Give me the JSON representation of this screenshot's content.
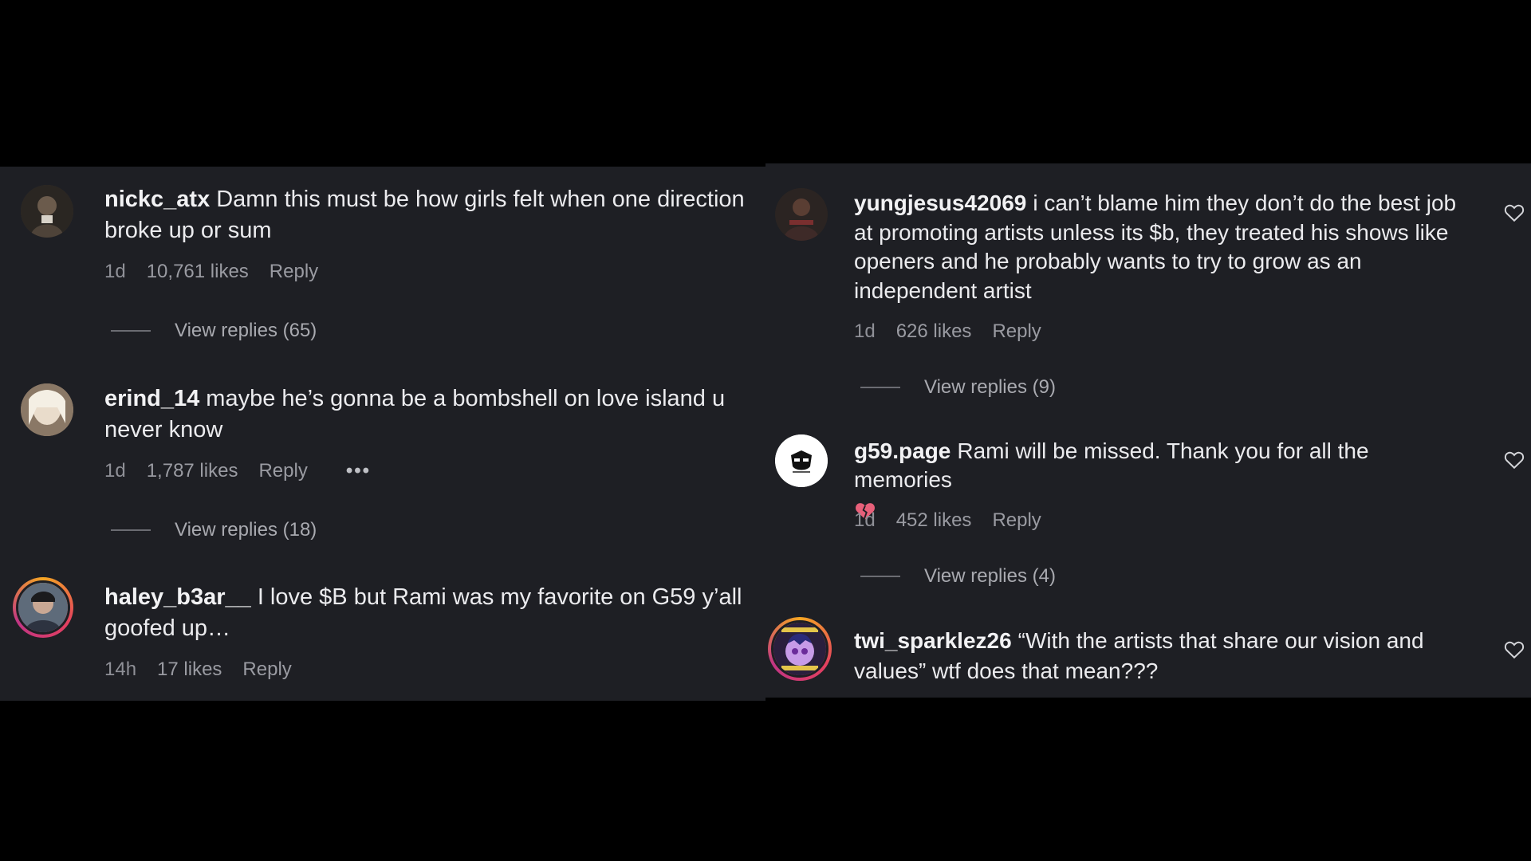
{
  "left_comments": [
    {
      "username": "nickc_atx",
      "text": "Damn this must be how girls felt when one direction broke up or sum",
      "time": "1d",
      "likes": "10,761 likes",
      "reply": "Reply",
      "view_replies": "View replies (65)"
    },
    {
      "username": "erind_14",
      "text": "maybe he’s gonna be a bombshell on love island u never know",
      "time": "1d",
      "likes": "1,787 likes",
      "reply": "Reply",
      "more": "•••",
      "view_replies": "View replies (18)"
    },
    {
      "username": "haley_b3ar__",
      "text": "I love $B but Rami was my favorite on G59 y’all goofed up…",
      "time": "14h",
      "likes": "17 likes",
      "reply": "Reply"
    }
  ],
  "right_comments": [
    {
      "username": "yungjesus42069",
      "text": "i can’t blame him they don’t do the best job at promoting artists unless its $b, they treated his shows like openers and he probably wants to try to grow as an independent artist",
      "time": "1d",
      "likes": "626 likes",
      "reply": "Reply",
      "view_replies": "View replies (9)"
    },
    {
      "username": "g59.page",
      "text": "Rami will be missed. Thank you for all the memories",
      "time": "1d",
      "likes": "452 likes",
      "reply": "Reply",
      "view_replies": "View replies (4)"
    },
    {
      "username": "twi_sparklez26",
      "text": "“With the artists that share our vision and values” wtf does that mean???"
    }
  ],
  "icons": {
    "like": "heart-outline-icon",
    "broken_heart": "broken-heart-emoji"
  },
  "colors": {
    "panel_bg": "#1e1f24",
    "page_bg": "#000000",
    "muted_text": "#9a9ba2",
    "broken_heart": "#e8607a"
  }
}
